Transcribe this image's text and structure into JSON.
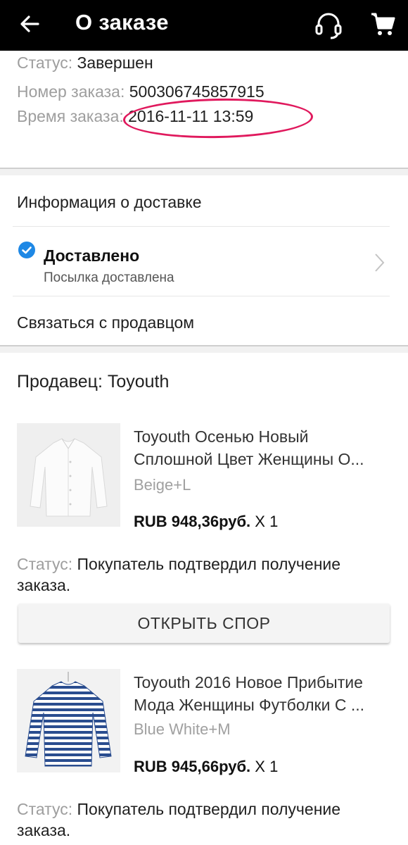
{
  "appbar": {
    "title": "О заказе",
    "back_icon": "arrow-left-icon",
    "support_icon": "headset-icon",
    "cart_icon": "cart-icon",
    "background": "#000000"
  },
  "order": {
    "status_label": "Статус:",
    "status_value": "Завершен",
    "number_label": "Номер заказа:",
    "number_value": "5003067458579",
    "number_tail": "15",
    "time_label": "Время заказа:",
    "time_value": "2016-11-11 13:59"
  },
  "delivery": {
    "section_title": "Информация о доставке",
    "status_title": "Доставлено",
    "status_subtitle": "Посылка доставлена",
    "contact_seller": "Связаться с продавцом",
    "check_color": "#1e88e5"
  },
  "seller": {
    "label": "Продавец: Toyouth"
  },
  "items": [
    {
      "title_line1": "Toyouth Осенью Новый",
      "title_line2": "Сплошной Цвет Женщины О...",
      "variant": "Beige+L",
      "price": "RUB 948,36руб.",
      "qty": "X 1",
      "status_label": "Статус:",
      "status_value_line1": "Покупатель подтвердил получение",
      "status_value_line2": "заказа.",
      "image": "white-shirt-image"
    },
    {
      "title_line1": "Toyouth 2016 Новое Прибытие",
      "title_line2": "Мода Женщины Футболки С ...",
      "variant": "Blue White+M",
      "price": "RUB 945,66руб.",
      "qty": "X 1",
      "status_label": "Статус:",
      "status_value_line1": "Покупатель подтвердил получение",
      "status_value_line2": "заказа.",
      "image": "striped-shirt-image"
    }
  ],
  "actions": {
    "open_dispute": "ОТКРЫТЬ СПОР"
  },
  "colors": {
    "highlight_ring": "#e0195d",
    "label_gray": "#9e9e9e"
  }
}
